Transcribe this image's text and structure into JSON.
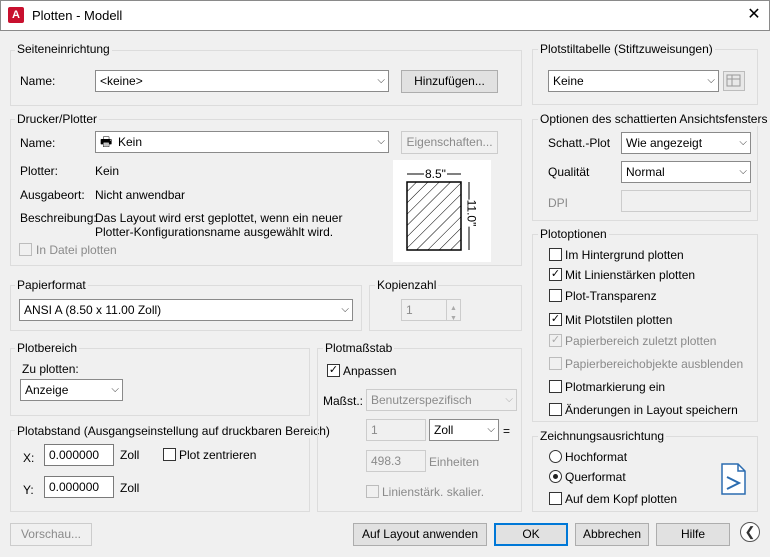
{
  "window": {
    "title": "Plotten - Modell",
    "app_icon_letter": "A",
    "close_glyph": "✕"
  },
  "seiteneinrichtung": {
    "title": "Seiteneinrichtung",
    "name_label": "Name:",
    "name_value": "<keine>",
    "add_button": "Hinzufügen..."
  },
  "drucker": {
    "title": "Drucker/Plotter",
    "name_label": "Name:",
    "name_value": "Kein",
    "properties_button": "Eigenschaften...",
    "plotter_label": "Plotter:",
    "plotter_value": "Kein",
    "ausgabeort_label": "Ausgabeort:",
    "ausgabeort_value": "Nicht anwendbar",
    "beschreibung_label": "Beschreibung:",
    "beschreibung_line1": "Das Layout wird erst geplottet, wenn ein neuer",
    "beschreibung_line2": "Plotter-Konfigurationsname ausgewählt wird.",
    "in_datei_label": "In Datei plotten",
    "preview_width": "8.5\"",
    "preview_height": "11.0\""
  },
  "papierformat": {
    "title": "Papierformat",
    "value": "ANSI A (8.50 x 11.00 Zoll)"
  },
  "kopienzahl": {
    "title": "Kopienzahl",
    "value": "1"
  },
  "plotbereich": {
    "title": "Plotbereich",
    "zu_plotten_label": "Zu plotten:",
    "value": "Anzeige"
  },
  "plotabstand": {
    "title": "Plotabstand (Ausgangseinstellung auf druckbaren Bereich)",
    "x_label": "X:",
    "x_value": "0.000000",
    "x_unit": "Zoll",
    "y_label": "Y:",
    "y_value": "0.000000",
    "y_unit": "Zoll",
    "zentrieren_label": "Plot zentrieren"
  },
  "plotmassstab": {
    "title": "Plotmaßstab",
    "anpassen_label": "Anpassen",
    "massst_label": "Maßst.:",
    "massst_value": "Benutzerspezifisch",
    "value1": "1",
    "unit": "Zoll",
    "equals": "=",
    "value2": "498.3",
    "einheiten_label": "Einheiten",
    "linienstaerk_label": "Linienstärk. skalier."
  },
  "plotstiltabelle": {
    "title": "Plotstiltabelle (Stiftzuweisungen)",
    "value": "Keine"
  },
  "schattiert": {
    "title": "Optionen des schattierten Ansichtsfensters",
    "schatt_label": "Schatt.-Plot",
    "schatt_value": "Wie angezeigt",
    "qualitaet_label": "Qualität",
    "qualitaet_value": "Normal",
    "dpi_label": "DPI"
  },
  "plotoptionen": {
    "title": "Plotoptionen",
    "items": [
      "Im Hintergrund plotten",
      "Mit Linienstärken plotten",
      "Plot-Transparenz",
      "Mit Plotstilen plotten",
      "Papierbereich zuletzt plotten",
      "Papierbereichobjekte ausblenden",
      "Plotmarkierung ein",
      "Änderungen in Layout speichern"
    ]
  },
  "ausrichtung": {
    "title": "Zeichnungsausrichtung",
    "hochformat": "Hochformat",
    "querformat": "Querformat",
    "kopf": "Auf dem Kopf plotten"
  },
  "footer": {
    "vorschau": "Vorschau...",
    "auf_layout": "Auf Layout anwenden",
    "ok": "OK",
    "abbrechen": "Abbrechen",
    "hilfe": "Hilfe",
    "expand_glyph": "❮"
  }
}
